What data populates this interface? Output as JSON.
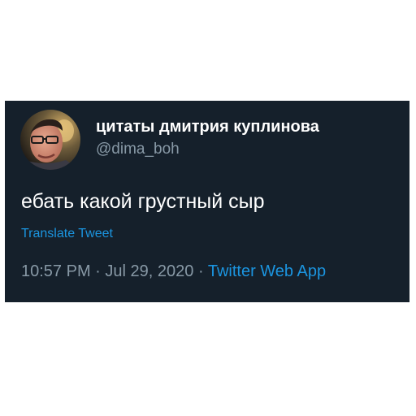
{
  "tweet": {
    "display_name": "цитаты дмитрия куплинова",
    "handle": "@dima_boh",
    "text": "ебать какой грустный сыр",
    "translate_label": "Translate Tweet",
    "time": "10:57 PM",
    "date": "Jul 29, 2020",
    "separator": "·",
    "source": "Twitter Web App"
  },
  "colors": {
    "background": "#15202b",
    "primary_text": "#ffffff",
    "secondary_text": "#8899a6",
    "link": "#1b95e0"
  },
  "icons": {
    "avatar": "profile-photo"
  }
}
